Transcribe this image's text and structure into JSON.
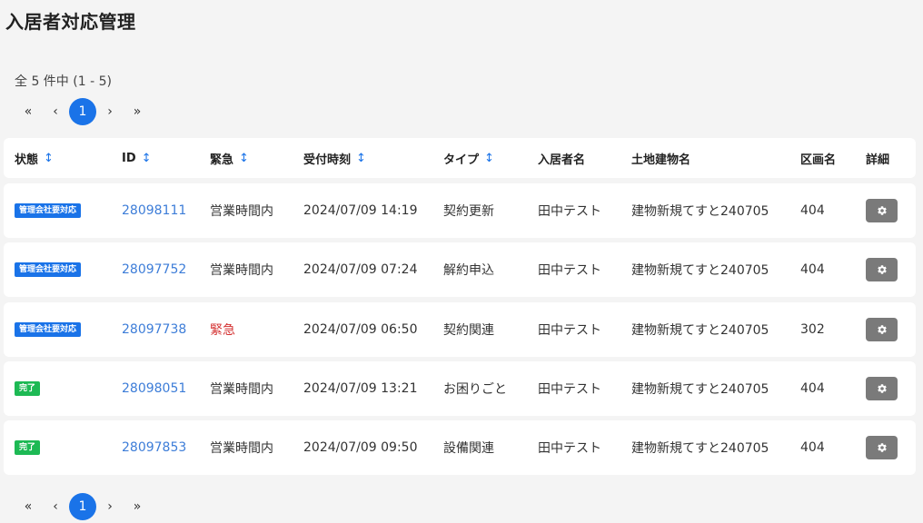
{
  "title": "入居者対応管理",
  "count_text": "全 5 件中 (1 - 5)",
  "pager": {
    "first": "«",
    "prev": "‹",
    "current": "1",
    "next": "›",
    "last": "»"
  },
  "columns": {
    "status": "状態",
    "id": "ID",
    "urgent": "緊急",
    "received": "受付時刻",
    "type": "タイプ",
    "resident": "入居者名",
    "building": "土地建物名",
    "section": "区画名",
    "detail": "詳細",
    "sort_icon": "↕"
  },
  "colors": {
    "accent": "#1a73e8",
    "done": "#1db954",
    "urgent": "#d32f2f",
    "gear_button": "#7a7a7a"
  },
  "rows": [
    {
      "status": "管理会社要対応",
      "status_type": "mgmt",
      "id": "28098111",
      "urgent": "営業時間内",
      "received": "2024/07/09 14:19",
      "type": "契約更新",
      "resident": "田中テスト",
      "building": "建物新規てすと240705",
      "section": "404"
    },
    {
      "status": "管理会社要対応",
      "status_type": "mgmt",
      "id": "28097752",
      "urgent": "営業時間内",
      "received": "2024/07/09 07:24",
      "type": "解約申込",
      "resident": "田中テスト",
      "building": "建物新規てすと240705",
      "section": "404"
    },
    {
      "status": "管理会社要対応",
      "status_type": "mgmt",
      "id": "28097738",
      "urgent": "緊急",
      "received": "2024/07/09 06:50",
      "type": "契約関連",
      "resident": "田中テスト",
      "building": "建物新規てすと240705",
      "section": "302"
    },
    {
      "status": "完了",
      "status_type": "done",
      "id": "28098051",
      "urgent": "営業時間内",
      "received": "2024/07/09 13:21",
      "type": "お困りごと",
      "resident": "田中テスト",
      "building": "建物新規てすと240705",
      "section": "404"
    },
    {
      "status": "完了",
      "status_type": "done",
      "id": "28097853",
      "urgent": "営業時間内",
      "received": "2024/07/09 09:50",
      "type": "設備関連",
      "resident": "田中テスト",
      "building": "建物新規てすと240705",
      "section": "404"
    }
  ]
}
